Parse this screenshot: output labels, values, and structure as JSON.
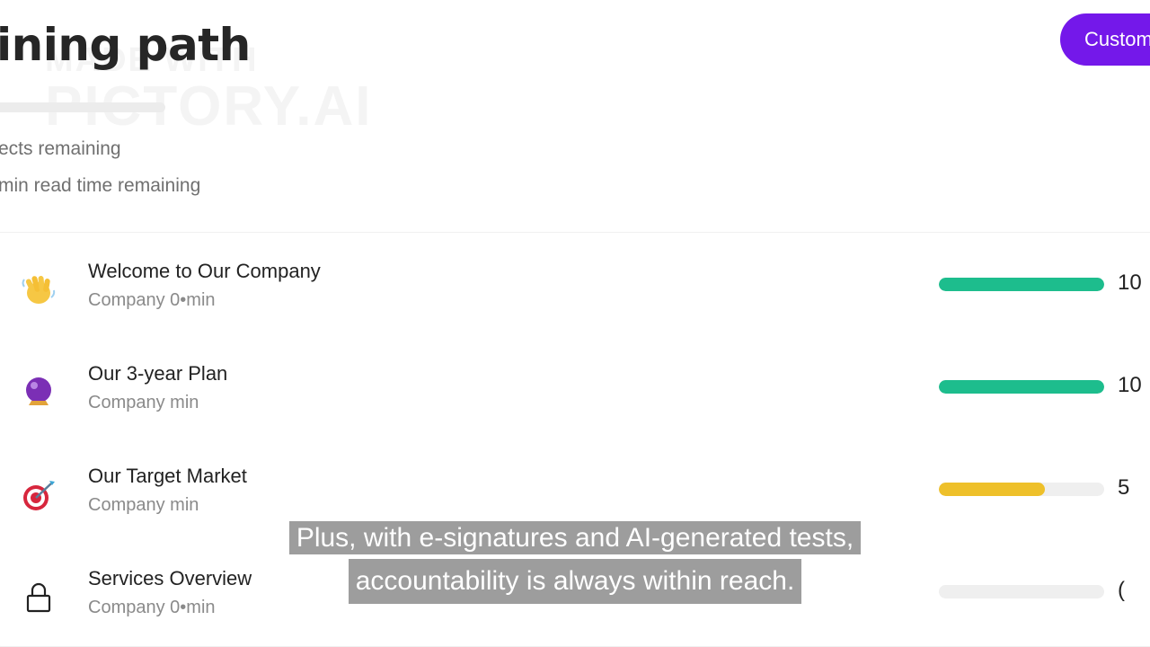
{
  "header": {
    "title": "ining path",
    "watermark_line1": "MADE WITH",
    "watermark_line2": "PICTORY.AI",
    "cta_label": "Custom"
  },
  "overall_progress": {
    "fraction": 0.03,
    "color": "#ee8a33"
  },
  "stats": {
    "subjects_remaining": "ects remaining",
    "read_time_remaining": "min read time remaining"
  },
  "subjects": [
    {
      "icon": "waving-hand-icon",
      "title": "Welcome to Our Company",
      "meta": "Company 0•min",
      "progress": 1.0,
      "bar_color": "#1dbd8d",
      "percent_label": "10"
    },
    {
      "icon": "crystal-ball-icon",
      "title": "Our 3-year Plan",
      "meta": "Company  min",
      "progress": 1.0,
      "bar_color": "#1dbd8d",
      "percent_label": "10"
    },
    {
      "icon": "target-icon",
      "title": "Our Target Market",
      "meta": "Company  min",
      "progress": 0.64,
      "bar_color": "#eec02a",
      "percent_label": "5"
    },
    {
      "icon": "lock-icon",
      "title": "Services Overview",
      "meta": "Company 0•min",
      "progress": 0,
      "bar_color": "#efefef",
      "percent_label": "("
    }
  ],
  "caption": {
    "line1": "Plus, with e-signatures and AI-generated tests,",
    "line2": "accountability is always within reach."
  }
}
